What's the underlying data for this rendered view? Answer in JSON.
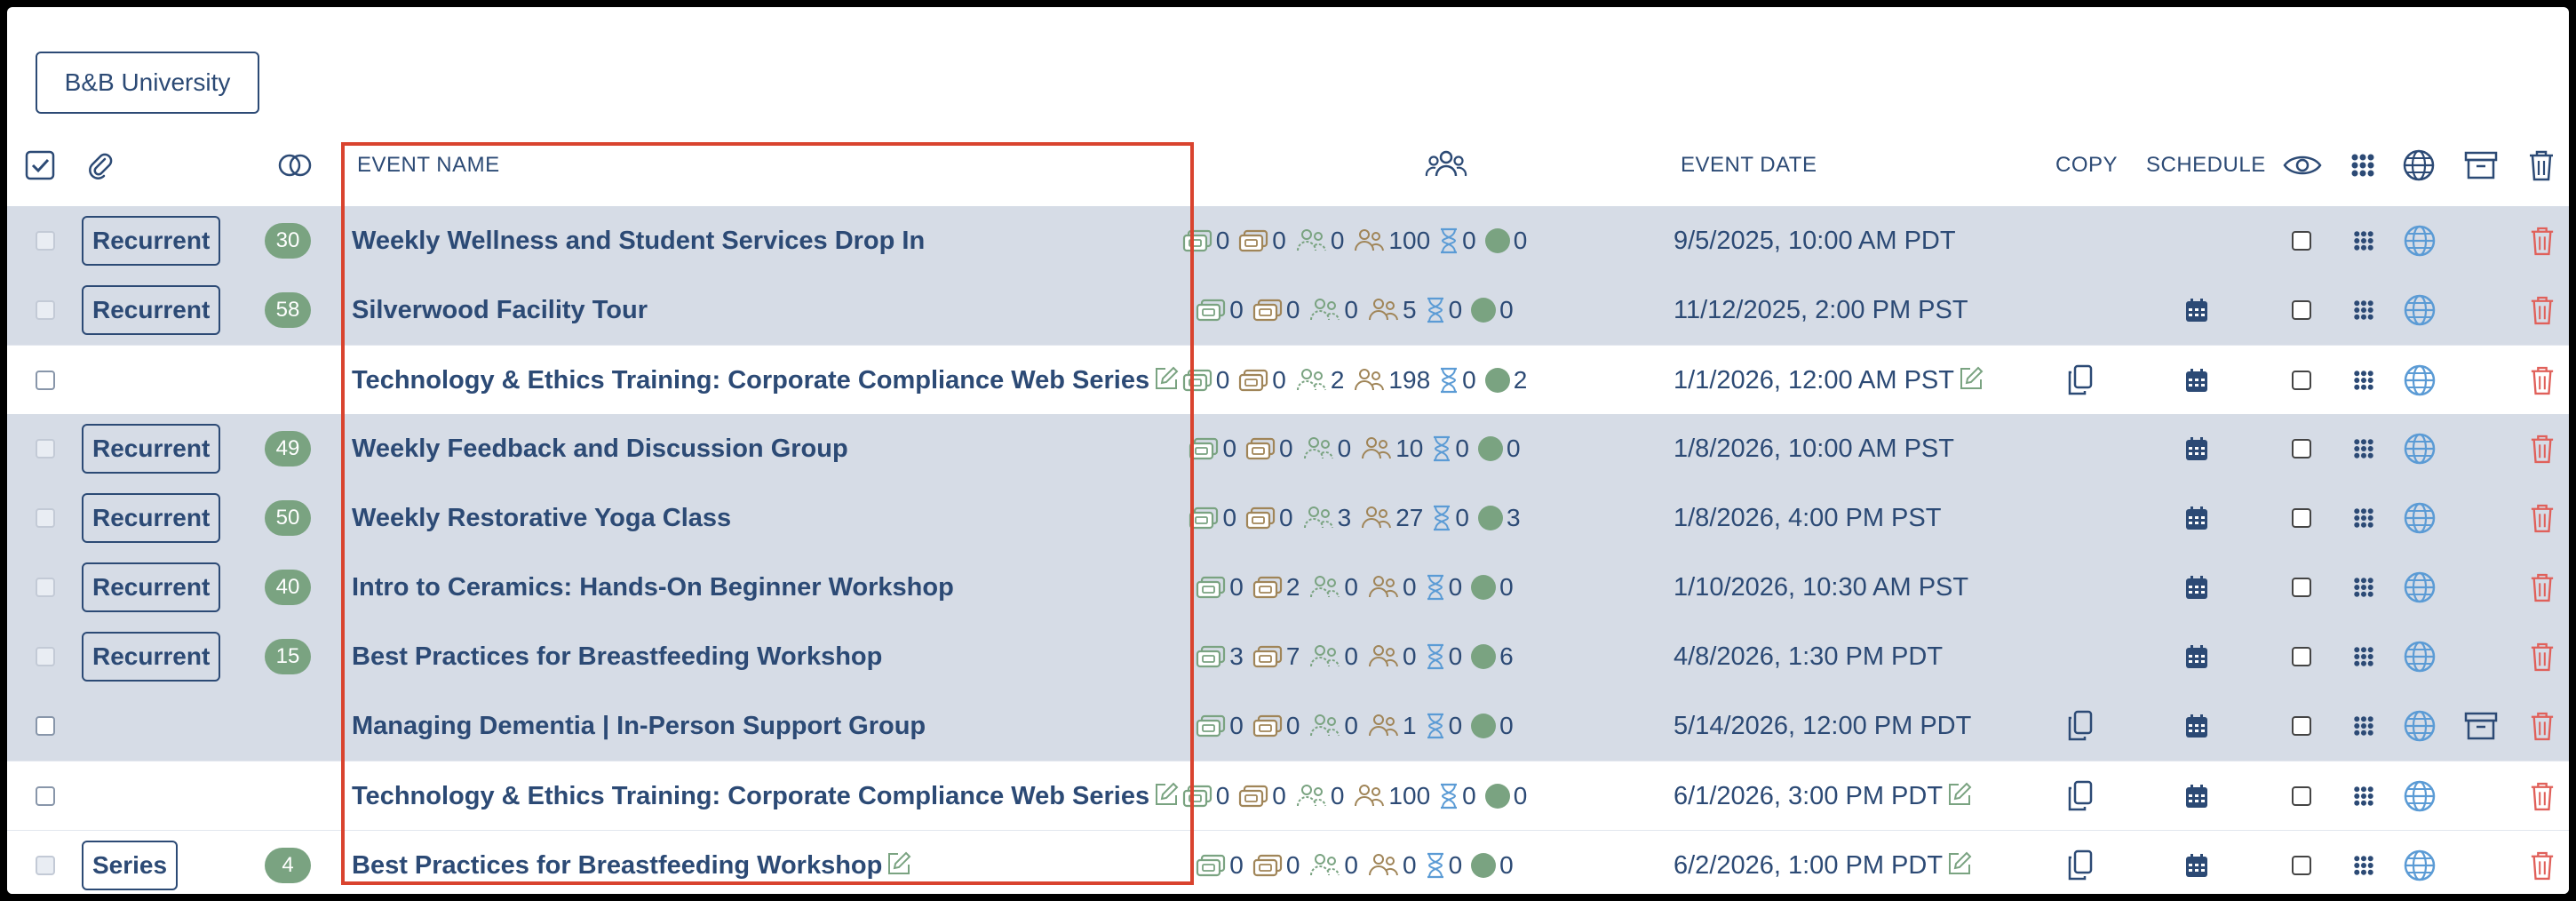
{
  "org_button": "B&B University",
  "header": {
    "event_name": "EVENT NAME",
    "event_date": "EVENT DATE",
    "copy": "COPY",
    "schedule": "SCHEDULE"
  },
  "rows": [
    {
      "bg": "grey",
      "type": "Recurrent",
      "count": "30",
      "name": "Weekly Wellness and Student Services Drop In",
      "edit": false,
      "s": [
        "0",
        "0",
        "0",
        "100",
        "0",
        "0"
      ],
      "date": "9/5/2025, 10:00 AM PDT",
      "date_edit": false,
      "copy": false,
      "schedule": false,
      "archive": false
    },
    {
      "bg": "grey",
      "type": "Recurrent",
      "count": "58",
      "name": "Silverwood Facility Tour",
      "edit": false,
      "s": [
        "0",
        "0",
        "0",
        "5",
        "0",
        "0"
      ],
      "date": "11/12/2025, 2:00 PM PST",
      "date_edit": false,
      "copy": false,
      "schedule": true,
      "archive": false
    },
    {
      "bg": "white",
      "type": "",
      "count": "",
      "name": "Technology & Ethics Training: Corporate Compliance Web Series",
      "edit": true,
      "s": [
        "0",
        "0",
        "2",
        "198",
        "0",
        "2"
      ],
      "date": "1/1/2026, 12:00 AM PST",
      "date_edit": true,
      "copy": true,
      "schedule": true,
      "archive": false
    },
    {
      "bg": "grey",
      "type": "Recurrent",
      "count": "49",
      "name": "Weekly Feedback and Discussion Group",
      "edit": false,
      "s": [
        "0",
        "0",
        "0",
        "10",
        "0",
        "0"
      ],
      "date": "1/8/2026, 10:00 AM PST",
      "date_edit": false,
      "copy": false,
      "schedule": true,
      "archive": false
    },
    {
      "bg": "grey",
      "type": "Recurrent",
      "count": "50",
      "name": "Weekly Restorative Yoga Class",
      "edit": false,
      "s": [
        "0",
        "0",
        "3",
        "27",
        "0",
        "3"
      ],
      "date": "1/8/2026, 4:00 PM PST",
      "date_edit": false,
      "copy": false,
      "schedule": true,
      "archive": false
    },
    {
      "bg": "grey",
      "type": "Recurrent",
      "count": "40",
      "name": "Intro to Ceramics: Hands-On Beginner Workshop",
      "edit": false,
      "s": [
        "0",
        "2",
        "0",
        "0",
        "0",
        "0"
      ],
      "date": "1/10/2026, 10:30 AM PST",
      "date_edit": false,
      "copy": false,
      "schedule": true,
      "archive": false
    },
    {
      "bg": "grey",
      "type": "Recurrent",
      "count": "15",
      "name": "Best Practices for Breastfeeding Workshop",
      "edit": false,
      "s": [
        "3",
        "7",
        "0",
        "0",
        "0",
        "6"
      ],
      "date": "4/8/2026, 1:30 PM PDT",
      "date_edit": false,
      "copy": false,
      "schedule": true,
      "archive": false
    },
    {
      "bg": "grey",
      "type": "",
      "count": "",
      "name": "Managing Dementia | In-Person Support Group",
      "edit": false,
      "s": [
        "0",
        "0",
        "0",
        "1",
        "0",
        "0"
      ],
      "date": "5/14/2026, 12:00 PM PDT",
      "date_edit": false,
      "copy": true,
      "schedule": true,
      "archive": true
    },
    {
      "bg": "white",
      "type": "",
      "count": "",
      "name": "Technology & Ethics Training: Corporate Compliance Web Series",
      "edit": true,
      "s": [
        "0",
        "0",
        "0",
        "100",
        "0",
        "0"
      ],
      "date": "6/1/2026, 3:00 PM PDT",
      "date_edit": true,
      "copy": true,
      "schedule": true,
      "archive": false
    },
    {
      "bg": "white",
      "type": "Series",
      "count": "4",
      "name": "Best Practices for Breastfeeding Workshop",
      "edit": true,
      "s": [
        "0",
        "0",
        "0",
        "0",
        "0",
        "0"
      ],
      "date": "6/2/2026, 1:00 PM PDT",
      "date_edit": true,
      "copy": true,
      "schedule": true,
      "archive": false
    }
  ],
  "colors": {
    "navy": "#2c4a75",
    "green": "#7aa381",
    "tan": "#a08558",
    "sky": "#5b9bd5",
    "red": "#e0605a",
    "row_grey": "#d6dce6",
    "highlight": "#d9432e"
  }
}
